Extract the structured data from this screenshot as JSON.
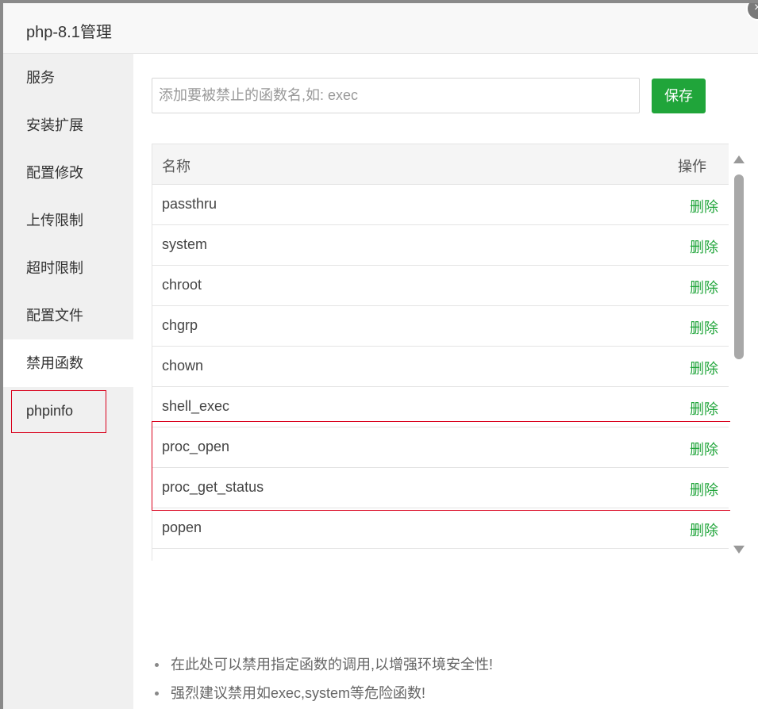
{
  "dialog": {
    "title": "php-8.1管理",
    "close_glyph": "×"
  },
  "sidebar": {
    "items": [
      {
        "label": "服务",
        "active": false
      },
      {
        "label": "安装扩展",
        "active": false
      },
      {
        "label": "配置修改",
        "active": false
      },
      {
        "label": "上传限制",
        "active": false
      },
      {
        "label": "超时限制",
        "active": false
      },
      {
        "label": "配置文件",
        "active": false
      },
      {
        "label": "禁用函数",
        "active": true
      },
      {
        "label": "phpinfo",
        "active": false
      }
    ]
  },
  "form": {
    "input_placeholder": "添加要被禁止的函数名,如: exec",
    "input_value": "",
    "save_label": "保存"
  },
  "table": {
    "headers": {
      "name": "名称",
      "action": "操作"
    },
    "rows": [
      {
        "name": "passthru",
        "action": "删除"
      },
      {
        "name": "system",
        "action": "删除"
      },
      {
        "name": "chroot",
        "action": "删除"
      },
      {
        "name": "chgrp",
        "action": "删除"
      },
      {
        "name": "chown",
        "action": "删除"
      },
      {
        "name": "shell_exec",
        "action": "删除"
      },
      {
        "name": "proc_open",
        "action": "删除"
      },
      {
        "name": "proc_get_status",
        "action": "删除"
      },
      {
        "name": "popen",
        "action": "删除"
      }
    ]
  },
  "tips": [
    "在此处可以禁用指定函数的调用,以增强环境安全性!",
    "强烈建议禁用如exec,system等危险函数!"
  ],
  "colors": {
    "accent": "#20a53a",
    "highlight": "#d9001b",
    "sidebar_bg": "#f0f0f0"
  }
}
